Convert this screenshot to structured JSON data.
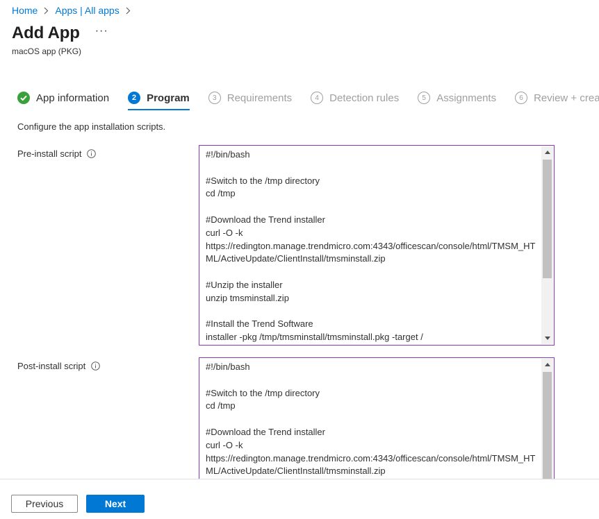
{
  "breadcrumb": {
    "home": "Home",
    "apps": "Apps | All apps"
  },
  "page": {
    "title": "Add App",
    "more": "···",
    "subtitle": "macOS app (PKG)"
  },
  "wizard": {
    "steps": [
      {
        "number": "",
        "label": "App information",
        "state": "done"
      },
      {
        "number": "2",
        "label": "Program",
        "state": "current"
      },
      {
        "number": "3",
        "label": "Requirements",
        "state": "future"
      },
      {
        "number": "4",
        "label": "Detection rules",
        "state": "future"
      },
      {
        "number": "5",
        "label": "Assignments",
        "state": "future"
      },
      {
        "number": "6",
        "label": "Review + create",
        "state": "future"
      }
    ]
  },
  "description": "Configure the app installation scripts.",
  "pre_install": {
    "label": "Pre-install script",
    "value": "#!/bin/bash\n\n#Switch to the /tmp directory\ncd /tmp\n\n#Download the Trend installer\ncurl -O -k\nhttps://redington.manage.trendmicro.com:4343/officescan/console/html/TMSM_HTML/ActiveUpdate/ClientInstall/tmsminstall.zip\n\n#Unzip the installer\nunzip tmsminstall.zip\n\n#Install the Trend Software\ninstaller -pkg /tmp/tmsminstall/tmsminstall.pkg -target /"
  },
  "post_install": {
    "label": "Post-install script",
    "value": "#!/bin/bash\n\n#Switch to the /tmp directory\ncd /tmp\n\n#Download the Trend installer\ncurl -O -k\nhttps://redington.manage.trendmicro.com:4343/officescan/console/html/TMSM_HTML/ActiveUpdate/ClientInstall/tmsminstall.zip"
  },
  "footer": {
    "previous": "Previous",
    "next": "Next"
  },
  "colors": {
    "accent": "#0078d4",
    "success": "#3aa13a",
    "focus_border": "#8a3ab4"
  }
}
